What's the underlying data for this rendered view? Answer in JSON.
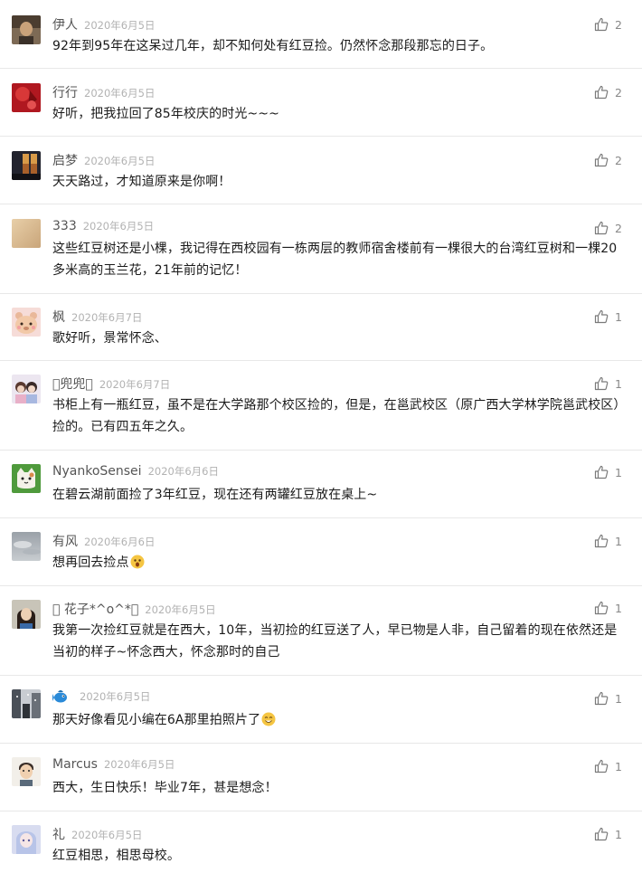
{
  "comments": [
    {
      "name": "伊人",
      "time": "2020年6月5日",
      "text": "92年到95年在这呆过几年，却不知何处有红豆捡。仍然怀念那段那忘的日子。",
      "likes": "2",
      "avatar_icon": "man-portrait-avatar",
      "colors": [
        "#5b4a3a",
        "#c9a27a"
      ]
    },
    {
      "name": "行行",
      "time": "2020年6月5日",
      "text": "好听，把我拉回了85年校庆的时光~~~",
      "likes": "2",
      "avatar_icon": "red-figure-avatar",
      "colors": [
        "#b01820",
        "#e04040"
      ]
    },
    {
      "name": "启梦",
      "time": "2020年6月5日",
      "text": "天天路过，才知道原来是你啊！",
      "likes": "2",
      "avatar_icon": "sunset-window-avatar",
      "colors": [
        "#2c2c3a",
        "#d89a48"
      ]
    },
    {
      "name": "333",
      "time": "2020年6月5日",
      "text": "这些红豆树还是小棵，我记得在西校园有一栋两层的教师宿舍楼前有一棵很大的台湾红豆树和一棵20多米高的玉兰花，21年前的记忆！",
      "likes": "2",
      "avatar_icon": "beige-blank-avatar",
      "colors": [
        "#d9b98e",
        "#e8cfa8"
      ]
    },
    {
      "name": "枫",
      "time": "2020年6月7日",
      "text": "歌好听，景常怀念、",
      "likes": "1",
      "avatar_icon": "cartoon-bear-avatar",
      "colors": [
        "#f6d9d6",
        "#c98a6a"
      ]
    },
    {
      "name": "󰀀兜兜󰀀",
      "time": "2020年6月7日",
      "text": "书柜上有一瓶红豆，虽不是在大学路那个校区捡的，但是，在邕武校区（原广西大学林学院邕武校区）捡的。已有四五年之久。",
      "likes": "1",
      "avatar_icon": "couple-photo-avatar",
      "colors": [
        "#e9e2ee",
        "#8a6a5a"
      ]
    },
    {
      "name": "NyankoSensei",
      "time": "2020年6月6日",
      "text": "在碧云湖前面捡了3年红豆，现在还有两罐红豆放在桌上~",
      "likes": "1",
      "avatar_icon": "cat-cartoon-avatar",
      "colors": [
        "#4f9a3c",
        "#f4f1e8"
      ]
    },
    {
      "name": "有风",
      "time": "2020年6月6日",
      "text": "想再回去捡点",
      "likes": "1",
      "avatar_icon": "cloudy-sky-avatar",
      "colors": [
        "#8d949b",
        "#c4c9cd"
      ],
      "emoji": "surprised-face-emoji"
    },
    {
      "name": "󰀀 花子*^o^*󰀀",
      "time": "2020年6月5日",
      "text": "我第一次捡红豆就是在西大，10年，当初捡的红豆送了人，早已物是人非，自己留着的现在依然还是当初的样子~怀念西大，怀念那时的自己",
      "likes": "1",
      "avatar_icon": "girl-portrait-avatar",
      "colors": [
        "#3a2a24",
        "#e6c8a8"
      ]
    },
    {
      "name": "",
      "time": "2020年6月5日",
      "text": "那天好像看见小编在6A那里拍照片了",
      "likes": "1",
      "avatar_icon": "snowy-street-avatar",
      "colors": [
        "#4a5058",
        "#c8ccd2"
      ],
      "emoji": "smile-face-emoji",
      "name_icon": "blue-fish-icon"
    },
    {
      "name": "Marcus",
      "time": "2020年6月5日",
      "text": "西大，生日快乐！毕业7年，甚是想念！",
      "likes": "1",
      "avatar_icon": "cartoon-man-avatar",
      "colors": [
        "#f2efe9",
        "#3a2e28"
      ]
    },
    {
      "name": "礼",
      "time": "2020年6月5日",
      "text": "红豆相思，相思母校。",
      "likes": "1",
      "avatar_icon": "anime-girl-avatar",
      "colors": [
        "#b8c4e8",
        "#e8d8e8"
      ]
    }
  ]
}
